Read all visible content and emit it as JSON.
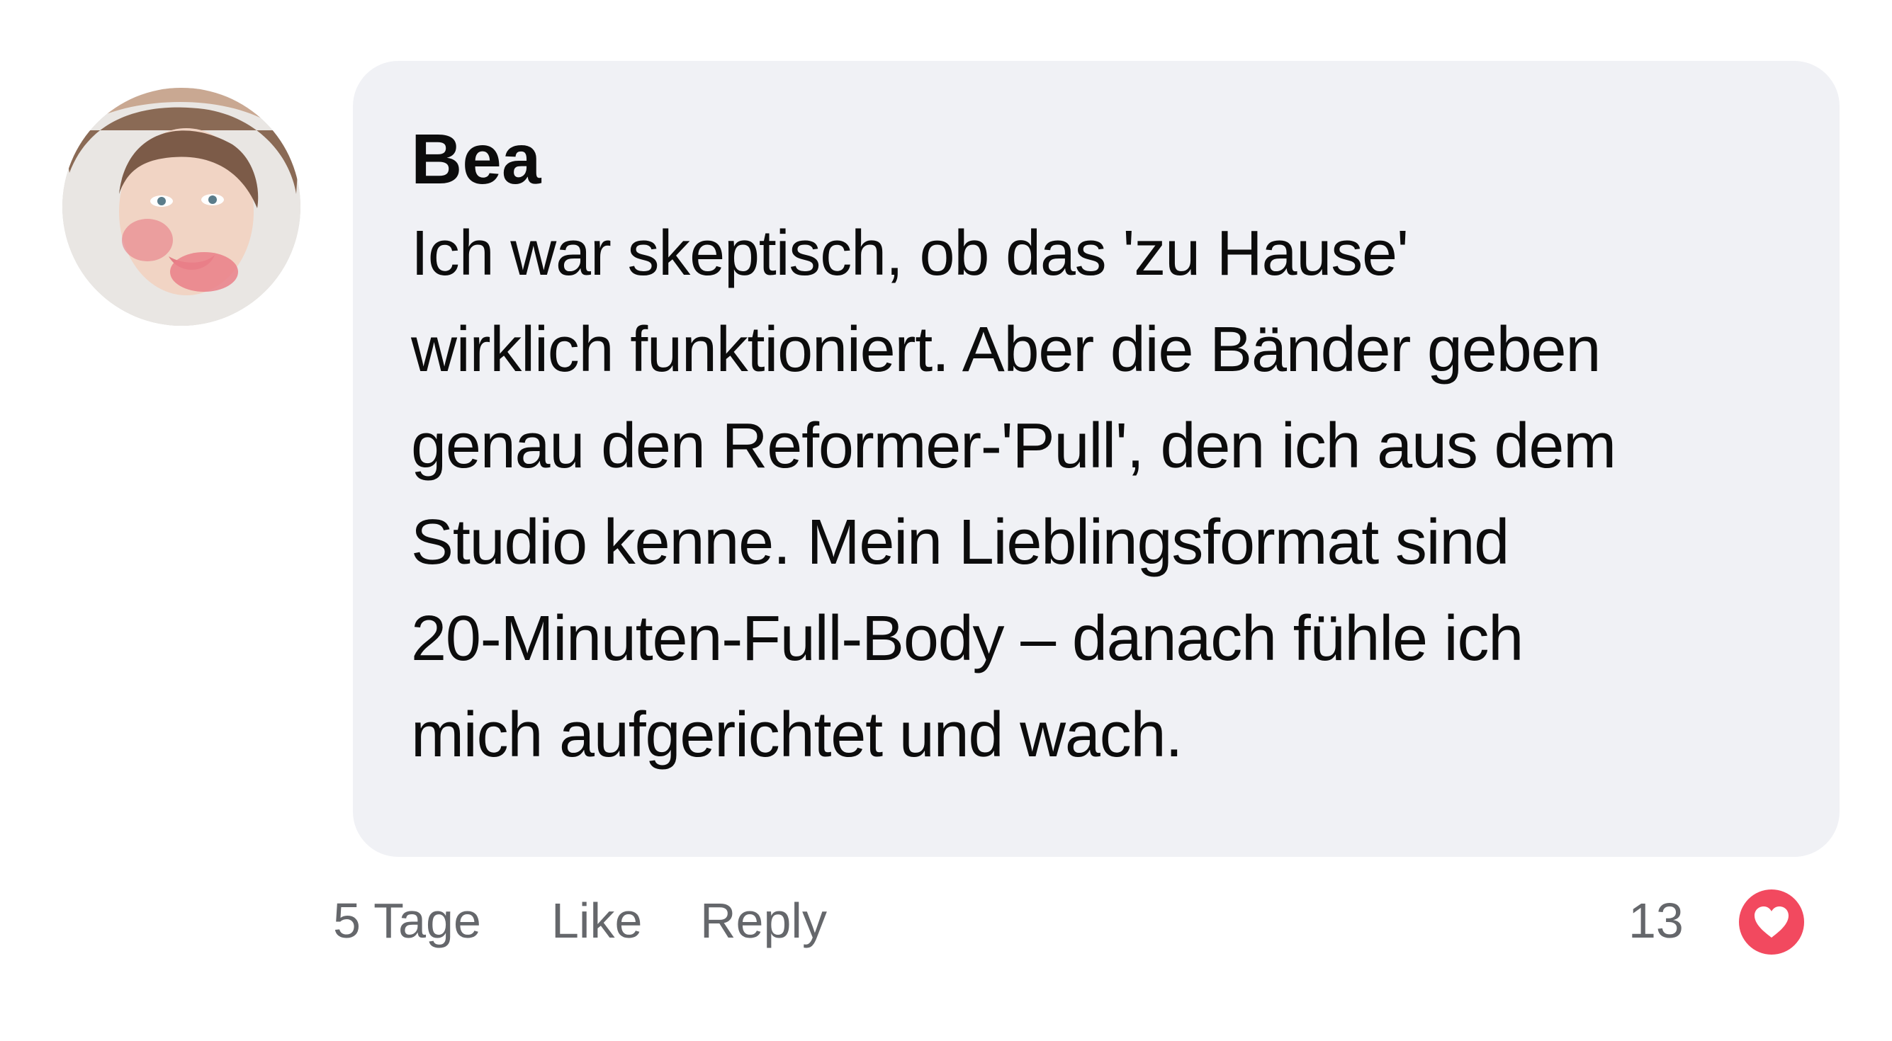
{
  "comment": {
    "author": "Bea",
    "avatar_icon": "user-photo-avatar",
    "text_lines": [
      "Ich war skeptisch, ob das 'zu Hause'",
      "wirklich funktioniert. Aber die Bänder geben",
      "genau den Reformer-'Pull', den ich aus dem",
      "Studio kenne. Mein Lieblingsformat sind",
      "20-Minuten-Full-Body – danach fühle ich",
      "mich aufgerichtet und wach."
    ],
    "timestamp": "5 Tage",
    "like_label": "Like",
    "reply_label": "Reply",
    "reaction_count": "13",
    "reaction_icon": "heart-icon"
  },
  "colors": {
    "bubble_background": "#f0f1f5",
    "meta_text": "#65676b",
    "heart_accent": "#f2495f",
    "body_text": "#0c0c0c"
  }
}
